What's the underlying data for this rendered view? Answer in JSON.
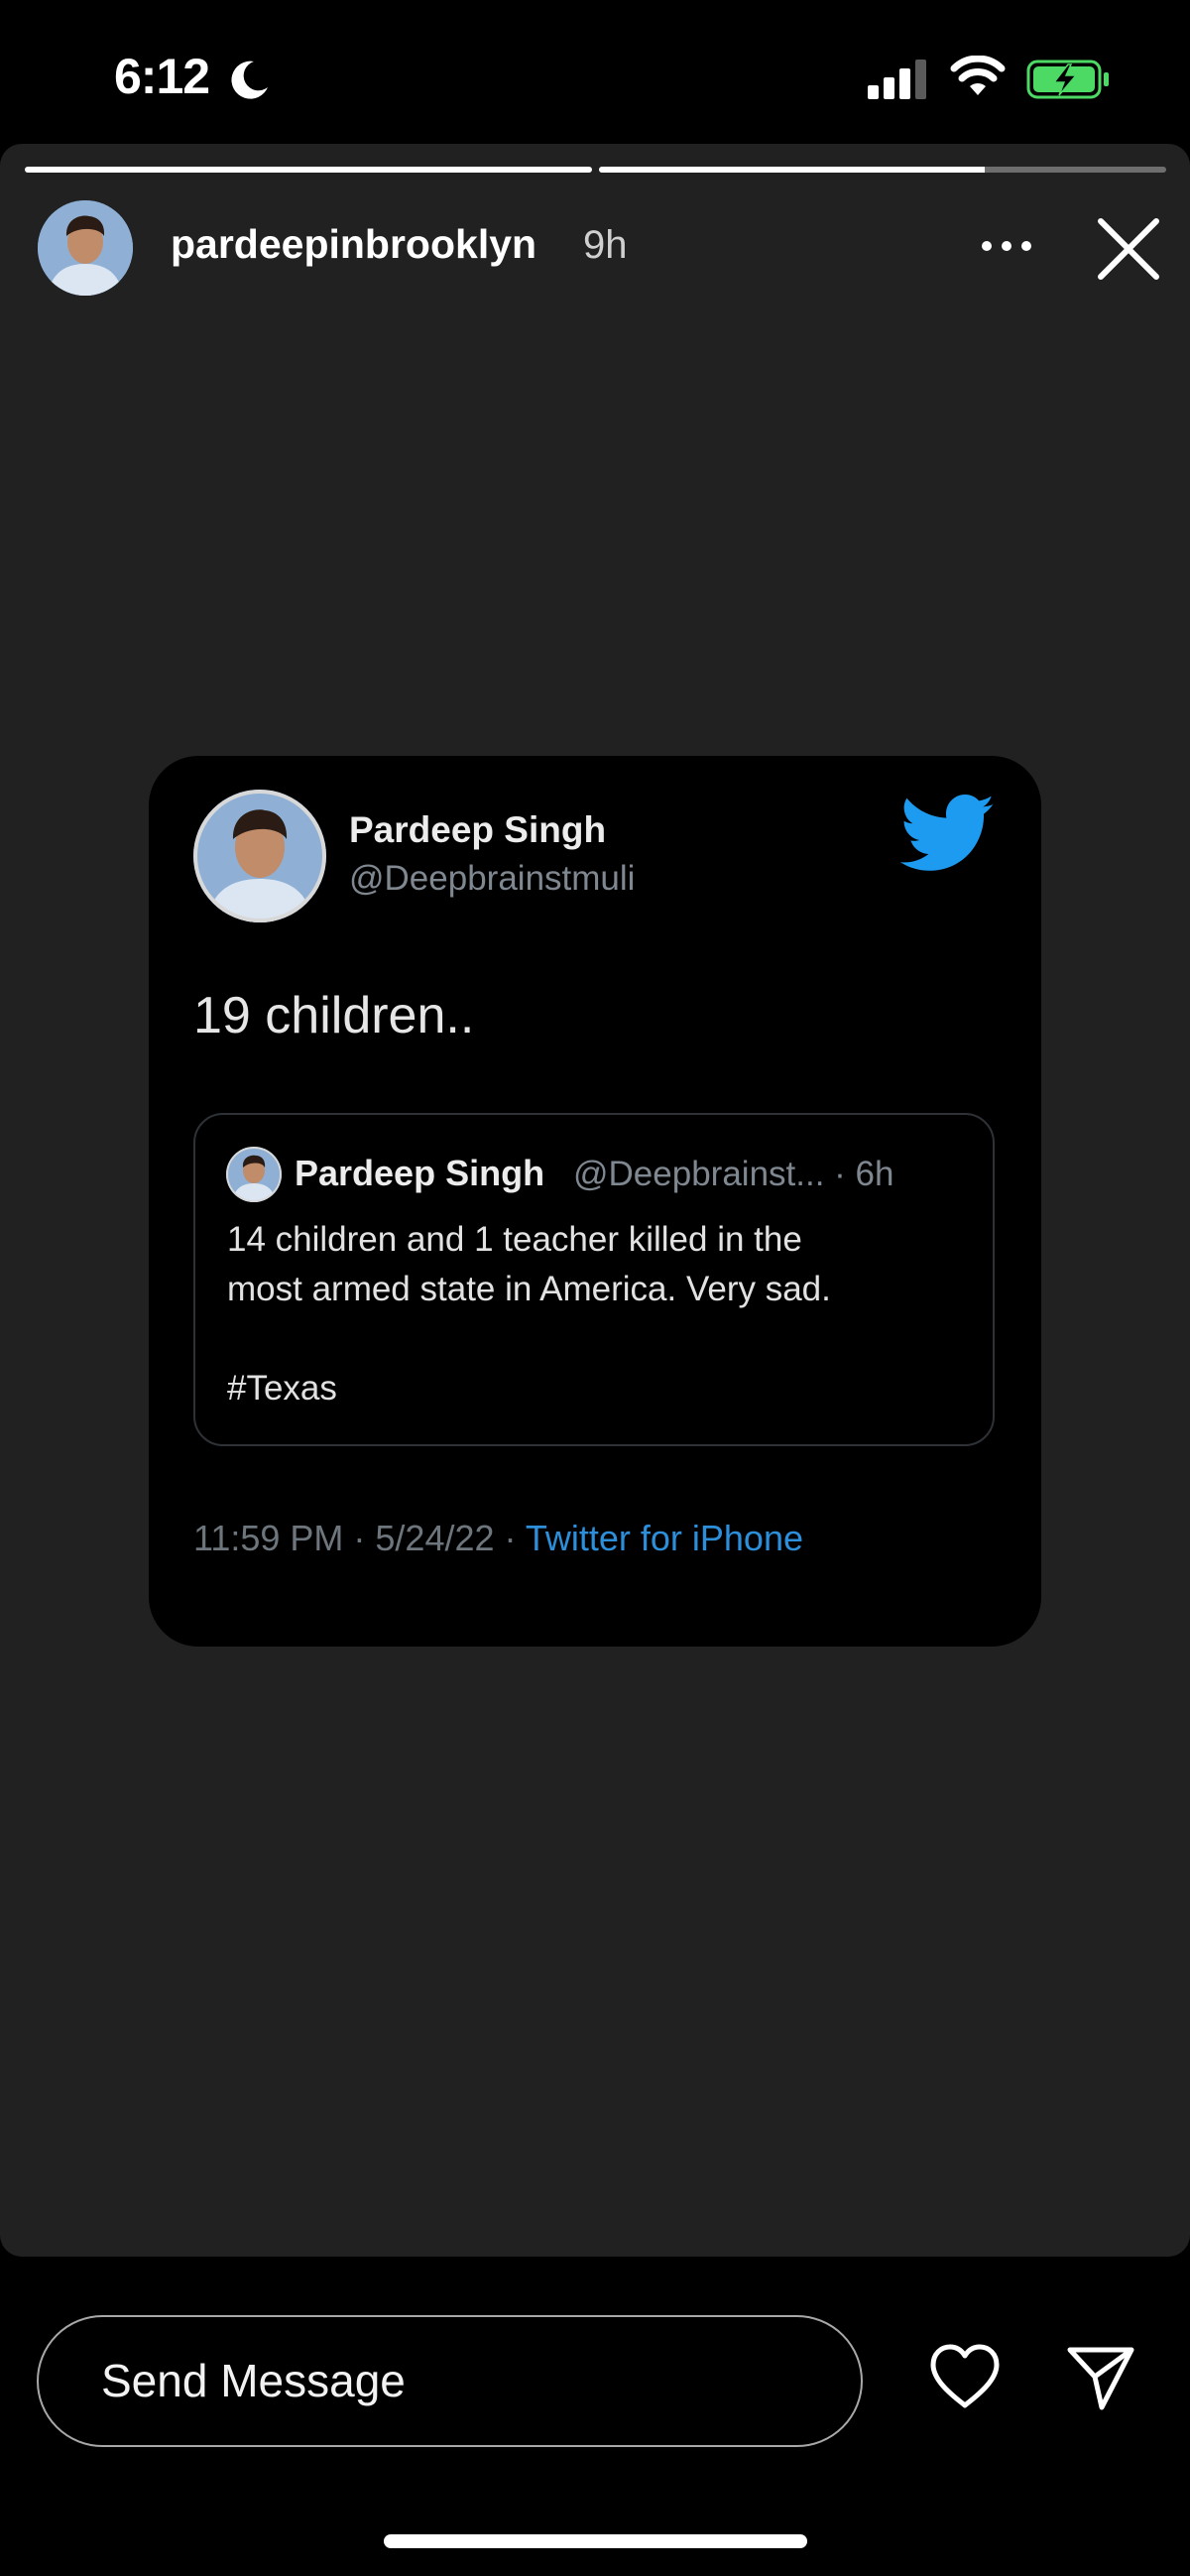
{
  "status_bar": {
    "time": "6:12",
    "icons": [
      "moon-icon",
      "cellular-signal-icon",
      "wifi-icon",
      "battery-charging-icon"
    ],
    "battery_color": "#4cd964"
  },
  "story": {
    "progress": [
      1.0,
      0.68
    ],
    "username": "pardeepinbrooklyn",
    "time_ago": "9h",
    "icons": [
      "more-options-icon",
      "close-icon"
    ]
  },
  "tweet": {
    "name": "Pardeep Singh",
    "handle": "@Deepbrainstmuli",
    "text": "19 children..",
    "quoted": {
      "name": "Pardeep Singh",
      "handle_time": "@Deepbrainst... · 6h",
      "line1": "14 children and 1 teacher killed in the",
      "line2": "most armed state in America. Very sad.",
      "hashtag": "#Texas"
    },
    "meta_time": "11:59 PM · 5/24/22 · ",
    "meta_source": "Twitter for iPhone",
    "brand_color": "#1d9bf0"
  },
  "footer": {
    "message_placeholder": "Send Message",
    "icons": [
      "heart-icon",
      "send-icon"
    ]
  }
}
